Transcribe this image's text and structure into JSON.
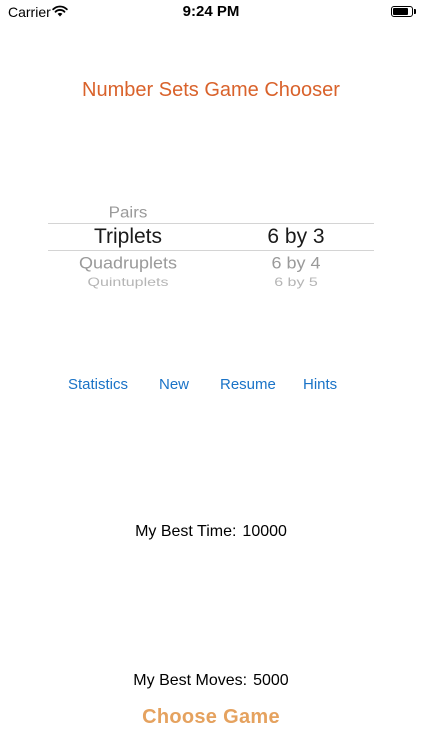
{
  "status_bar": {
    "carrier": "Carrier",
    "time": "9:24 PM",
    "battery_level": 0.9
  },
  "title": "Number Sets Game Chooser",
  "picker": {
    "left_column": {
      "items": [
        "Pairs",
        "Triplets",
        "Quadruplets",
        "Quintuplets"
      ],
      "selected": "Triplets"
    },
    "right_column": {
      "items": [
        "6 by 3",
        "6 by 4",
        "6 by 5"
      ],
      "selected": "6 by 3"
    }
  },
  "actions": [
    {
      "label": "Statistics"
    },
    {
      "label": "New"
    },
    {
      "label": "Resume"
    },
    {
      "label": "Hints"
    }
  ],
  "best_time": {
    "label": "My Best Time:",
    "value": "10000"
  },
  "best_moves": {
    "label": "My Best Moves:",
    "value": "5000"
  },
  "choose_button": "Choose Game",
  "colors": {
    "title": "#d9622b",
    "link": "#1a73c7",
    "choose": "#e5a25f"
  }
}
